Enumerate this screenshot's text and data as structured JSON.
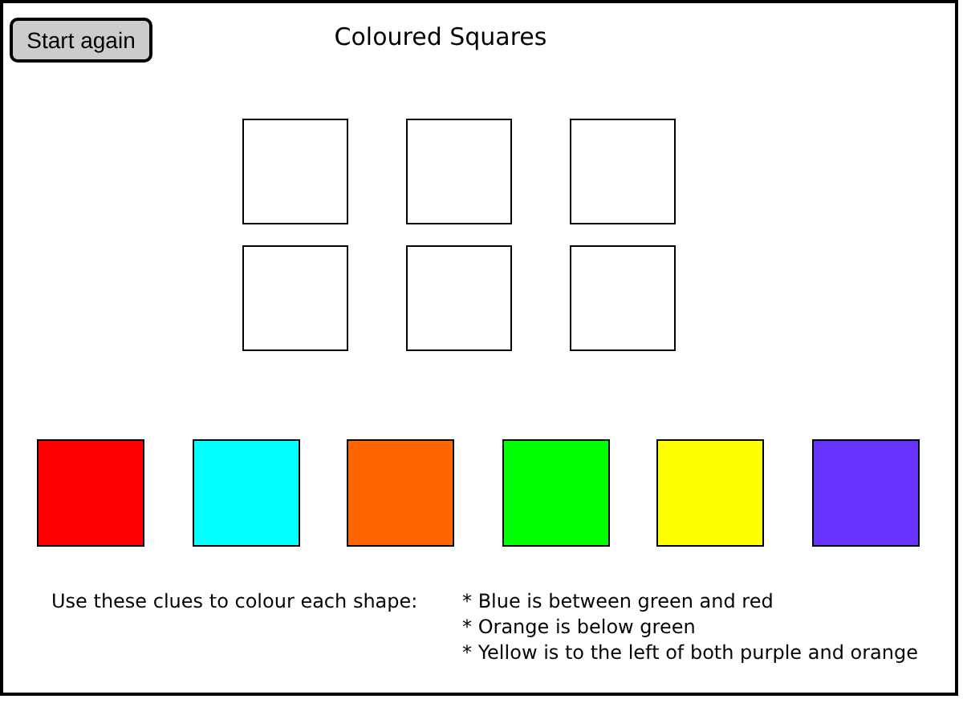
{
  "button": {
    "label": "Start again"
  },
  "title": "Coloured Squares",
  "targets": [
    {
      "filled": false
    },
    {
      "filled": false
    },
    {
      "filled": false
    },
    {
      "filled": false
    },
    {
      "filled": false
    },
    {
      "filled": false
    }
  ],
  "swatches": [
    {
      "color": "#ff0000"
    },
    {
      "color": "#00ffff"
    },
    {
      "color": "#ff6600"
    },
    {
      "color": "#00ff00"
    },
    {
      "color": "#ffff00"
    },
    {
      "color": "#6633ff"
    }
  ],
  "instructions": "Use these clues to colour each shape:",
  "clues": [
    "* Blue is between green and red",
    "* Orange is below green",
    "* Yellow is to the left of both purple and orange"
  ]
}
